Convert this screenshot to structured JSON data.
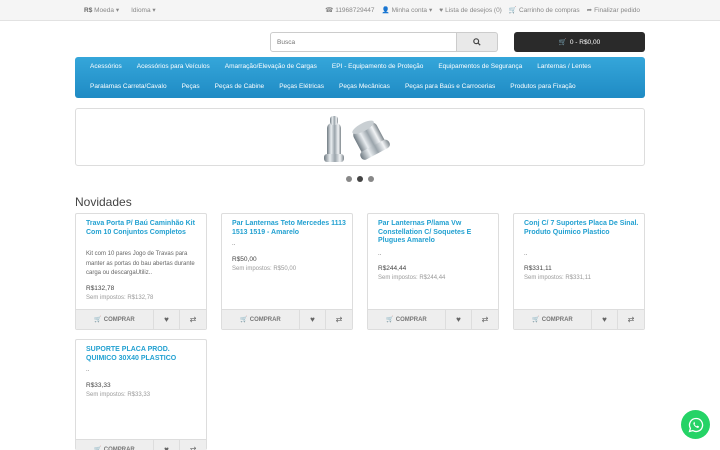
{
  "topbar": {
    "currency_symbol": "R$",
    "currency_label": "Moeda",
    "language_label": "Idioma",
    "phone": "11968729447",
    "account": "Minha conta",
    "wishlist": "Lista de desejos (0)",
    "cart": "Carrinho de compras",
    "checkout": "Finalizar pedido"
  },
  "search": {
    "placeholder": "Busca"
  },
  "cart_button": {
    "label": "0 - R$0,00"
  },
  "menu": {
    "row1": [
      "Acessórios",
      "Acessórios para Veículos",
      "Amarração/Elevação de Cargas",
      "EPI - Equipamento de Proteção",
      "Equipamentos de Segurança",
      "Lanternas / Lentes"
    ],
    "row2": [
      "Paralamas Carreta/Cavalo",
      "Peças",
      "Peças de Cabine",
      "Peças Elétricas",
      "Peças Mecânicas",
      "Peças para Baús e Carrocerias",
      "Produtos para Fixação"
    ]
  },
  "section_title": "Novidades",
  "products": [
    {
      "title": "Trava Porta P/ Baú Caminhão Kit Com 10 Conjuntos Completos",
      "description": "Kit com 10 pares Jogo de Travas para manter as portas do bau abertas durante carga ou descargaUtiliz..",
      "price": "R$132,78",
      "tax": "Sem impostos: R$132,78"
    },
    {
      "title": "Par Lanternas Teto Mercedes 1113 1513 1519 - Amarelo",
      "description": "..",
      "price": "R$50,00",
      "tax": "Sem impostos: R$50,00"
    },
    {
      "title": "Par Lanternas P/lama Vw Constellation C/ Soquetes E Plugues Amarelo",
      "description": "..",
      "price": "R$244,44",
      "tax": "Sem impostos: R$244,44"
    },
    {
      "title": "Conj C/ 7 Suportes Placa De Sinal. Produto Quimico Plastico",
      "description": "..",
      "price": "R$331,11",
      "tax": "Sem impostos: R$331,11"
    },
    {
      "title": "SUPORTE PLACA PROD. QUIMICO 30X40 PLASTICO",
      "description": "..",
      "price": "R$33,33",
      "tax": "Sem impostos: R$33,33"
    }
  ],
  "buy_label": "COMPRAR",
  "colors": {
    "accent": "#23a1d1",
    "menu": "#2a9bd3",
    "whatsapp": "#25d366",
    "cart_bg": "#2a2a2a"
  }
}
